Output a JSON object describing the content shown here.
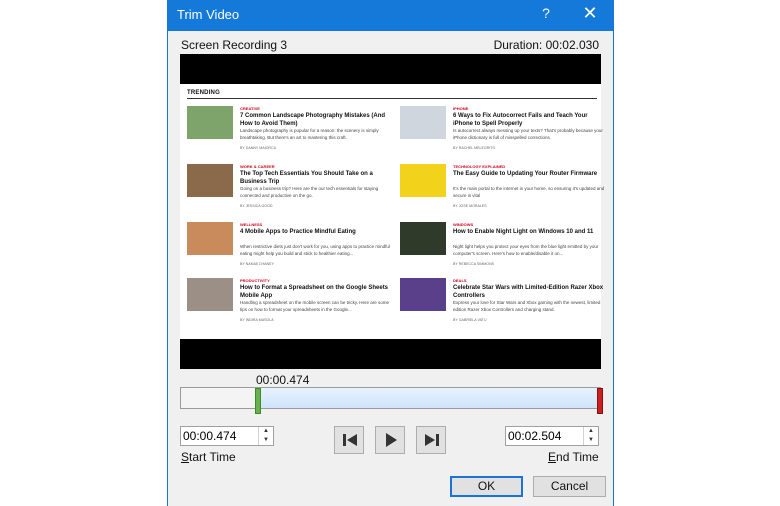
{
  "dialog": {
    "title": "Trim Video",
    "help_label": "?",
    "close_label": "✕"
  },
  "clip": {
    "name": "Screen Recording 3",
    "duration": "Duration: 00:02.030"
  },
  "preview": {
    "section_heading": "TRENDING",
    "cards": [
      {
        "category": "CREATIVE",
        "headline": "7 Common Landscape Photography Mistakes (And How to Avoid Them)",
        "desc": "Landscape photography is popular for a reason: the scenery is simply breathtaking. But there's an art to mastering this craft.",
        "author": "BY DANNY MAIORCA",
        "thumb_color": "#7ea36b"
      },
      {
        "category": "IPHONE",
        "headline": "6 Ways to Fix Autocorrect Fails and Teach Your iPhone to Spell Properly",
        "desc": "Is autocorrect always messing up your texts? That's probably because your iPhone dictionary is full of misspelled corrections.",
        "author": "BY RACHEL MELEGRITO",
        "thumb_color": "#cfd6dd"
      },
      {
        "category": "WORK & CAREER",
        "headline": "The Top Tech Essentials You Should Take on a Business Trip",
        "desc": "Going on a business trip? Here are the our tech essentials for staying connected and productive on the go.",
        "author": "BY JESSICA GOOD",
        "thumb_color": "#8a6a4a"
      },
      {
        "category": "TECHNOLOGY EXPLAINED",
        "headline": "The Easy Guide to Updating Your Router Firmware",
        "desc": "It's the main portal to the internet in your home, so ensuring it's updated and secure is vital",
        "author": "BY JOSE MORALES",
        "thumb_color": "#f2d21b"
      },
      {
        "category": "WELLNESS",
        "headline": "4 Mobile Apps to Practice Mindful Eating",
        "desc": "When restrictive diets just don't work for you, using apps to practice mindful eating might help you build and stick to healthier eating...",
        "author": "BY NAKAB CHANEY",
        "thumb_color": "#c98a5c"
      },
      {
        "category": "WINDOWS",
        "headline": "How to Enable Night Light on Windows 10 and 11",
        "desc": "Night light helps you protect your eyes from the blue light emitted by your computer's screen. Here's how to enable/disable it on...",
        "author": "BY REBECCA SIMMONS",
        "thumb_color": "#2f3a2a"
      },
      {
        "category": "PRODUCTIVITY",
        "headline": "How to Format a Spreadsheet on the Google Sheets Mobile App",
        "desc": "Handling a spreadsheet on the mobile screen can be tricky. Here are some tips on how to format your spreadsheets in the Google...",
        "author": "BY INDIRA MASOLA",
        "thumb_color": "#9c8f86"
      },
      {
        "category": "DEALS",
        "headline": "Celebrate Star Wars with Limited-Edition Razer Xbox Controllers",
        "desc": "Express your love for Star Wars and Xbox gaming with the newest, limited edition Razer Xbox Controllers and charging stand.",
        "author": "BY GABRIELA VATU",
        "thumb_color": "#5a3f8a"
      }
    ]
  },
  "playhead": {
    "time": "00:00.474"
  },
  "timeline": {
    "start_fraction": 0.2335,
    "end_fraction": 1.0
  },
  "start": {
    "value": "00:00.474",
    "label_underlined": "S",
    "label_rest": "tart Time"
  },
  "end": {
    "value": "00:02.504",
    "label_underlined": "E",
    "label_rest": "nd Time"
  },
  "buttons": {
    "ok": "OK",
    "cancel": "Cancel"
  },
  "colors": {
    "titlebar": "#1479d8",
    "accent": "#1a73d6",
    "start_handle": "#6ab04c",
    "end_handle": "#cc2020"
  }
}
